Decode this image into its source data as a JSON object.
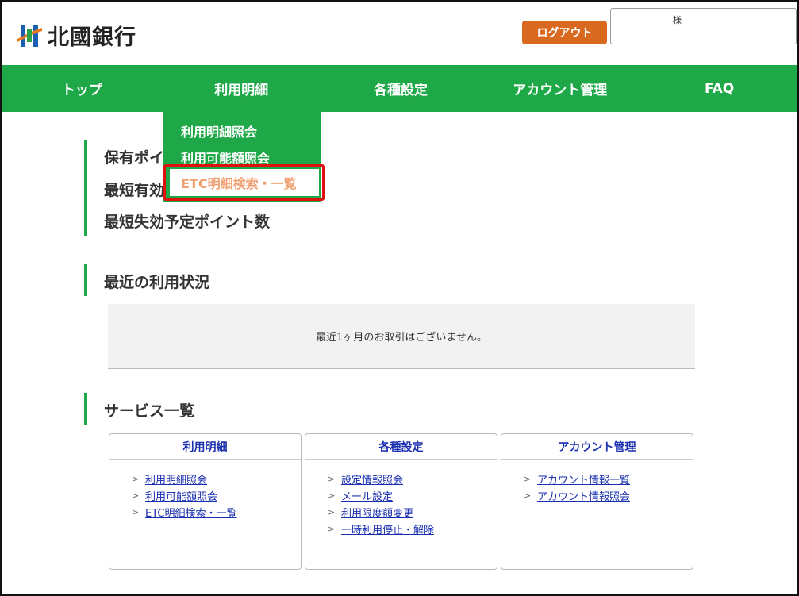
{
  "header": {
    "logo_text": "北國銀行",
    "logout_label": "ログアウト",
    "user_suffix": "様"
  },
  "nav": {
    "items": [
      "トップ",
      "利用明細",
      "各種設定",
      "アカウント管理",
      "FAQ"
    ]
  },
  "dropdown": {
    "items": [
      "利用明細照会",
      "利用可能額照会",
      "ETC明細検索・一覧"
    ]
  },
  "points": {
    "line1": "保有ポイ",
    "line2": "最短有効",
    "line3": "最短失効予定ポイント数"
  },
  "recent": {
    "title": "最近の利用状況",
    "empty_message": "最近1ヶ月のお取引はございません。"
  },
  "services": {
    "title": "サービス一覧",
    "cards": [
      {
        "title": "利用明細",
        "links": [
          "利用明細照会",
          "利用可能額照会",
          "ETC明細検索・一覧"
        ]
      },
      {
        "title": "各種設定",
        "links": [
          "設定情報照会",
          "メール設定",
          "利用限度額変更",
          "一時利用停止・解除"
        ]
      },
      {
        "title": "アカウント管理",
        "links": [
          "アカウント情報一覧",
          "アカウント情報照会"
        ]
      }
    ]
  },
  "colors": {
    "brand_green": "#1fa847",
    "logout_orange": "#d9691e",
    "highlight_red": "#e01010",
    "link_blue": "#1a2fb0"
  }
}
